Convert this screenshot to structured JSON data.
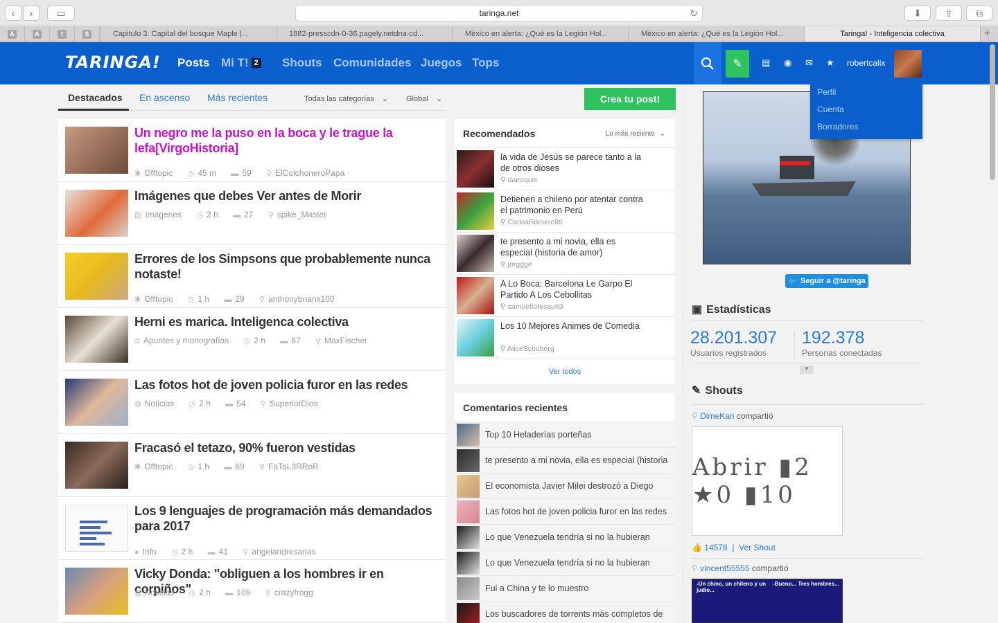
{
  "browser": {
    "url": "taringa.net",
    "tabs": [
      "Capitulo 3: Capital del bosque Maple |...",
      "1882-presscdn-0-36.pagely.netdna-cd...",
      "México en alerta: ¿Qué es la Legión Hol...",
      "México en alerta: ¿Qué es la Legión Hol...",
      "Taringa! - Inteligencia colectiva"
    ],
    "pinned": [
      "A",
      "A",
      "f",
      "S"
    ]
  },
  "header": {
    "logo": "TARINGA!",
    "nav": [
      "Posts",
      "Mi T!",
      "Shouts",
      "Comunidades",
      "Juegos",
      "Tops"
    ],
    "mit_badge": "2",
    "username": "robertcalix"
  },
  "user_menu": [
    "Perfil",
    "Cuenta",
    "Borradores"
  ],
  "filters": {
    "tabs": [
      "Destacados",
      "En ascenso",
      "Más recientes"
    ],
    "category": "Todas las categorías",
    "scope": "Global",
    "create_post": "Crea tu post!"
  },
  "posts": [
    {
      "title": "Un negro me la puso en la boca y le trague la lefa[VirgoHistoria]",
      "category": "Offtopic",
      "time": "45 m",
      "comments": "59",
      "author": "ElColchoneroPapa",
      "hot": true
    },
    {
      "title": "Imágenes que debes Ver antes de Morir",
      "category": "Imágenes",
      "time": "2 h",
      "comments": "27",
      "author": "spike_Master"
    },
    {
      "title": "Errores de los Simpsons que probablemente nunca notaste!",
      "category": "Offtopic",
      "time": "1 h",
      "comments": "29",
      "author": "anthonybrianx100"
    },
    {
      "title": "Herni es marica. Inteligenca colectiva",
      "category": "Apuntes y monografías",
      "time": "2 h",
      "comments": "67",
      "author": "MaxFischer"
    },
    {
      "title": "Las fotos hot de joven policia furor en las redes",
      "category": "Noticias",
      "time": "2 h",
      "comments": "54",
      "author": "SuperiorDios"
    },
    {
      "title": "Fracasó el tetazo, 90% fueron vestidas",
      "category": "Offtopic",
      "time": "1 h",
      "comments": "69",
      "author": "FaTaL3RRoR"
    },
    {
      "title": "Los 9 lenguajes de programación más demandados para 2017",
      "category": "Info",
      "time": "2 h",
      "comments": "41",
      "author": "angelandresarias"
    },
    {
      "title": "Vicky Donda: \"obliguen a los hombres ir en corpiños\"",
      "category": "Noticias",
      "time": "2 h",
      "comments": "109",
      "author": "crazyfrogg"
    }
  ],
  "recommended": {
    "title": "Recomendados",
    "sort": "Lo más reciente",
    "items": [
      {
        "title": "la vida de Jesús se parece tanto a la de otros dioses",
        "author": "dairoquis"
      },
      {
        "title": "Detienen a chileno por atentar contra el patrimonio en Perú",
        "author": "CarlosRomero96"
      },
      {
        "title": "te presento a mi novia, ella es especial (historia de amor)",
        "author": "jorggge"
      },
      {
        "title": "A Lo Boca: Barcelona Le Garpo El Partido A Los Cebollitas",
        "author": "samueltotesautt3"
      },
      {
        "title": "Los 10 Mejores Animes de Comedia",
        "author": "AliceSchuberg"
      }
    ],
    "see_all": "Ver todos"
  },
  "comments": {
    "title": "Comentarios recientes",
    "items": [
      "Top 10 Heladerías porteñas",
      "te presento a mi novia, ella es especial (historia",
      "El economista Javier Milei destrozó a Diego",
      "Las fotos hot de joven policia furor en las redes",
      "Lo que Venezuela tendría si no la hubieran",
      "Lo que Venezuela tendría si no la hubieran",
      "Fui a China y te lo muestro",
      "Los buscadores de torrents más completos de"
    ]
  },
  "sidebar": {
    "twitter": "Seguir a @taringa",
    "stats_title": "Estadísticas",
    "users_count": "28.201.307",
    "users_label": "Usuarios registrados",
    "online_count": "192.378",
    "online_label": "Personas conectadas",
    "shouts_title": "Shouts",
    "shout1_user": "DimeKari",
    "shared": "compartió",
    "shout1_img_text": "Abrir ▮2 ★0 ▮10",
    "likes": "14578",
    "see_shout": "Ver Shout",
    "shout2_user": "vincent55555",
    "shout2_caption_a": "-Un chino, un chileno y un judío...",
    "shout2_caption_b": "-Bueno... Tres hombres..."
  }
}
